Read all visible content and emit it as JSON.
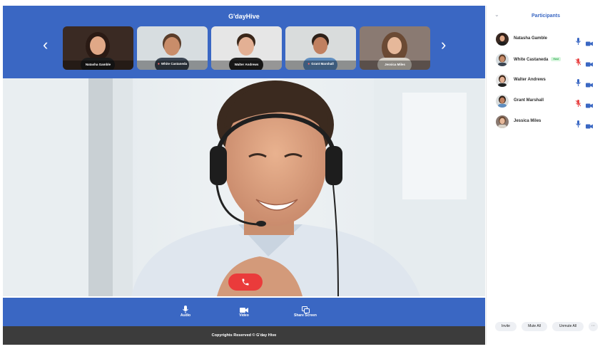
{
  "app": {
    "title": "G'dayHive"
  },
  "carousel": {
    "prev_icon": "chevron-left-icon",
    "next_icon": "chevron-right-icon",
    "thumbnails": [
      {
        "name": "Natasha Gamble",
        "muted": false,
        "bg": "#3a2a23",
        "skin": "#e0a887",
        "hair": "#2a1a14",
        "shirt": "#1d1d1d"
      },
      {
        "name": "White Castaneda",
        "muted": true,
        "bg": "#d7dde0",
        "skin": "#c98d6a",
        "hair": "#5a3d2a",
        "shirt": "#3b4552"
      },
      {
        "name": "Walter Andrews",
        "muted": false,
        "bg": "#e6e6e6",
        "skin": "#e3b094",
        "hair": "#3a2619",
        "shirt": "#222222"
      },
      {
        "name": "Grant Marshall",
        "muted": true,
        "bg": "#d9dcdc",
        "skin": "#c08060",
        "hair": "#2d2018",
        "shirt": "#5f8dbf"
      },
      {
        "name": "Jessica Miles",
        "muted": false,
        "bg": "#8a7a72",
        "skin": "#e6b89a",
        "hair": "#6b4a34",
        "shirt": "#d8d2c8"
      }
    ]
  },
  "video": {
    "end_call_color": "#ea3b3b"
  },
  "controls": [
    {
      "label": "Audio",
      "icon": "mic-icon"
    },
    {
      "label": "Video",
      "icon": "video-camera-icon"
    },
    {
      "label": "Share Screen",
      "icon": "share-screen-icon"
    }
  ],
  "footer": {
    "text": "Copyrights Reserved © G'day Hive"
  },
  "panel": {
    "title": "Participants",
    "participants": [
      {
        "name": "Natasha Gamble",
        "badge": "",
        "mic_on": true
      },
      {
        "name": "White Castaneda",
        "badge": "Host",
        "mic_on": false
      },
      {
        "name": "Walter Andrews",
        "badge": "",
        "mic_on": true
      },
      {
        "name": "Grant Marshall",
        "badge": "",
        "mic_on": false
      },
      {
        "name": "Jessica Miles",
        "badge": "",
        "mic_on": true
      }
    ],
    "actions": {
      "invite": "Invite",
      "mute_all": "Mute All",
      "unmute_all": "Unmute All",
      "more": "···"
    }
  },
  "colors": {
    "brand_blue": "#3a67c3",
    "mic_blue": "#3a67c3",
    "mic_muted": "#e84545",
    "footer_bg": "#3c3c3c"
  }
}
